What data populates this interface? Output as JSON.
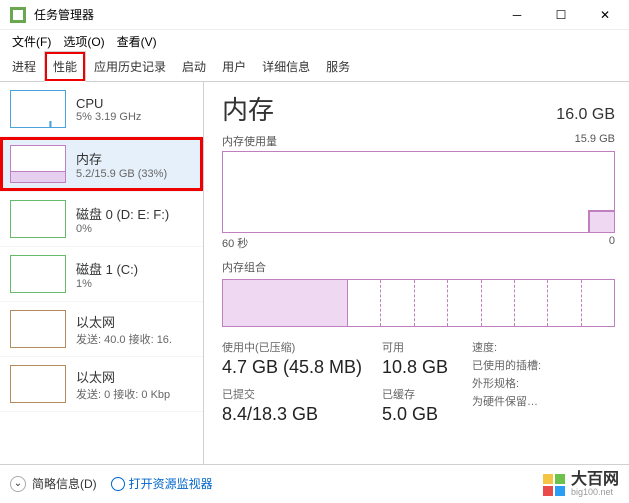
{
  "titlebar": {
    "title": "任务管理器"
  },
  "menubar": {
    "file": "文件(F)",
    "options": "选项(O)",
    "view": "查看(V)"
  },
  "tabs": {
    "processes": "进程",
    "performance": "性能",
    "apphistory": "应用历史记录",
    "startup": "启动",
    "users": "用户",
    "details": "详细信息",
    "services": "服务"
  },
  "sidebar": {
    "cpu": {
      "title": "CPU",
      "sub": "5% 3.19 GHz"
    },
    "mem": {
      "title": "内存",
      "sub": "5.2/15.9 GB (33%)"
    },
    "disk0": {
      "title": "磁盘 0 (D: E: F:)",
      "sub": "0%"
    },
    "disk1": {
      "title": "磁盘 1 (C:)",
      "sub": "1%"
    },
    "eth0": {
      "title": "以太网",
      "sub": "发送: 40.0 接收: 16."
    },
    "eth1": {
      "title": "以太网",
      "sub": "发送: 0 接收: 0 Kbp"
    }
  },
  "main": {
    "title": "内存",
    "total": "16.0 GB",
    "usage_label": "内存使用量",
    "usage_max": "15.9 GB",
    "x_left": "60 秒",
    "x_right": "0",
    "comp_label": "内存组合",
    "inuse_label": "使用中(已压缩)",
    "inuse_value": "4.7 GB (45.8 MB)",
    "avail_label": "可用",
    "avail_value": "10.8 GB",
    "committed_label": "已提交",
    "committed_value": "8.4/18.3 GB",
    "cached_label": "已缓存",
    "cached_value": "5.0 GB",
    "speed_label": "速度:",
    "slots_label": "已使用的插槽:",
    "form_label": "外形规格:",
    "reserved_label": "为硬件保留…"
  },
  "footer": {
    "brief": "简略信息(D)",
    "resmon": "打开资源监视器"
  },
  "watermark": {
    "name": "大百网",
    "url": "big100.net"
  }
}
